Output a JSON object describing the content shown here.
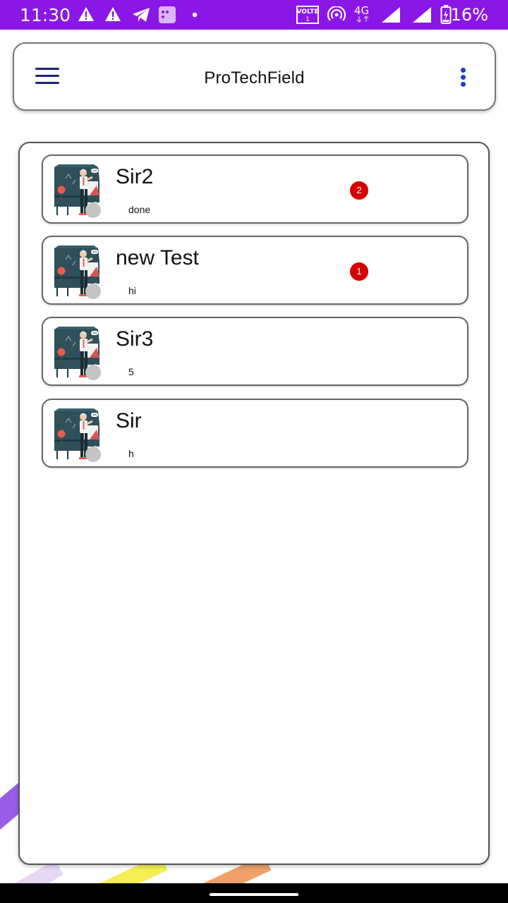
{
  "status_bar": {
    "time": "11:30",
    "battery": "16%",
    "network": "4G",
    "volte": "VOLTE",
    "sim": "1",
    "bg_color": "#8a17e6",
    "icons": [
      "warning-icon",
      "warning-icon",
      "telegram-icon",
      "gallery-icon",
      "dot-icon",
      "volte-icon",
      "hotspot-icon",
      "signal-icon",
      "signal-icon",
      "battery-icon"
    ]
  },
  "app_bar": {
    "title": "ProTechField",
    "menu_icon": "hamburger-menu-icon",
    "more_icon": "more-vert-icon",
    "accent": "#1a237e"
  },
  "chats": [
    {
      "name": "Sir2",
      "last_message": "done",
      "unread": "2"
    },
    {
      "name": "new Test",
      "last_message": "hi",
      "unread": "1"
    },
    {
      "name": "Sir3",
      "last_message": "5",
      "unread": null
    },
    {
      "name": "Sir",
      "last_message": "h",
      "unread": null
    }
  ],
  "colors": {
    "badge": "#d50000",
    "status_offline": "#c4c4c4"
  }
}
